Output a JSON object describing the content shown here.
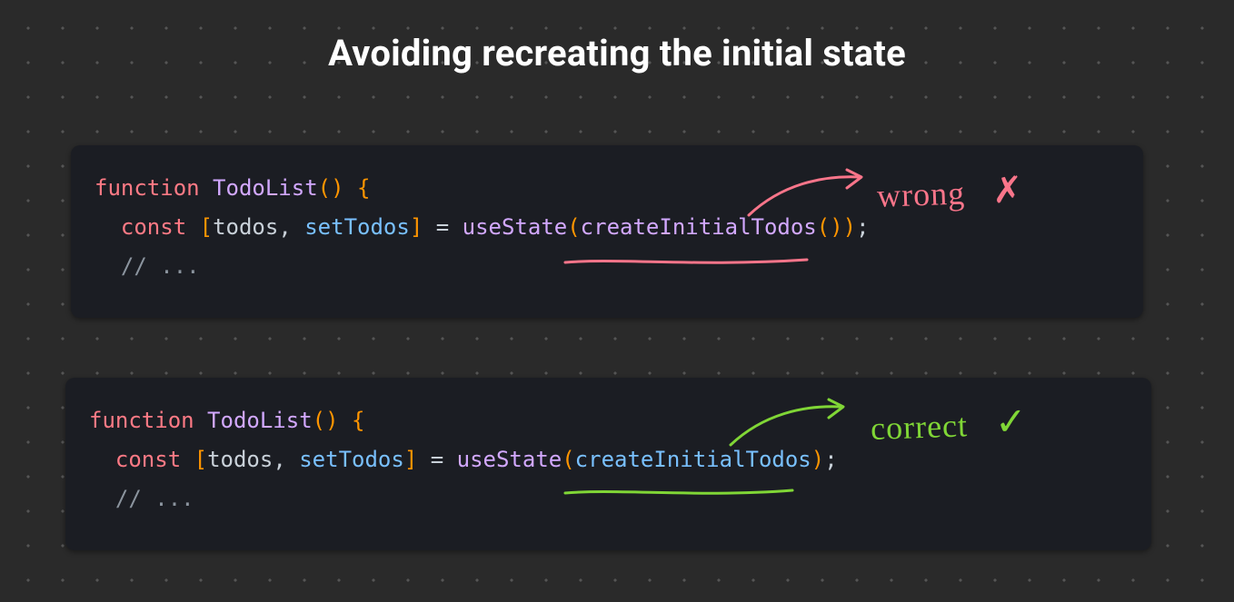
{
  "title": "Avoiding recreating the initial state",
  "wrong_block": {
    "tokens": {
      "t1": "function",
      "t2": " ",
      "t3": "TodoList",
      "t4": "()",
      "t5": " ",
      "t6": "{",
      "t7": "\n  ",
      "t8": "const",
      "t9": " ",
      "t10": "[",
      "t11": "todos",
      "t12": ", ",
      "t13": "setTodos",
      "t14": "]",
      "t15": " = ",
      "t16": "useState",
      "t17": "(",
      "t18": "createInitialTodos",
      "t19": "()",
      "t20": ")",
      "t21": ";",
      "t22": "\n  ",
      "t23": "// ..."
    }
  },
  "correct_block": {
    "tokens": {
      "t1": "function",
      "t2": " ",
      "t3": "TodoList",
      "t4": "()",
      "t5": " ",
      "t6": "{",
      "t7": "\n  ",
      "t8": "const",
      "t9": " ",
      "t10": "[",
      "t11": "todos",
      "t12": ", ",
      "t13": "setTodos",
      "t14": "]",
      "t15": " = ",
      "t16": "useState",
      "t17": "(",
      "t18": "createInitialTodos",
      "t19": ")",
      "t20": ";",
      "t21": "\n  ",
      "t22": "// ..."
    }
  },
  "annotations": {
    "wrong_label": "wrong",
    "wrong_mark": "✗",
    "correct_label": "correct",
    "correct_mark": "✓"
  },
  "colors": {
    "wrong": "#f9758a",
    "correct": "#80d636"
  }
}
